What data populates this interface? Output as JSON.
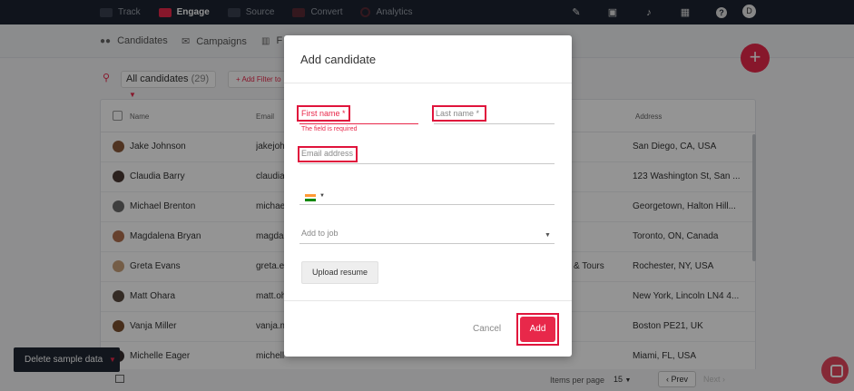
{
  "topnav": {
    "items": [
      {
        "label": "Track",
        "icon": "track-icon"
      },
      {
        "label": "Engage",
        "icon": "engage-icon"
      },
      {
        "label": "Source",
        "icon": "source-icon"
      },
      {
        "label": "Convert",
        "icon": "convert-icon"
      },
      {
        "label": "Analytics",
        "icon": "analytics-icon"
      }
    ],
    "active": "Engage",
    "right_icons": [
      "wand-icon",
      "clipboard-icon",
      "bell-icon",
      "calendar-icon",
      "help-icon"
    ],
    "avatar_initial": "D"
  },
  "subnav": {
    "tabs": [
      {
        "label": "Candidates",
        "icon": "people-icon"
      },
      {
        "label": "Campaigns",
        "icon": "mail-icon"
      },
      {
        "label": "F",
        "icon": "board-icon"
      }
    ],
    "fab_label": "+"
  },
  "filters": {
    "select_label": "All candidates",
    "select_count": "(29)",
    "add_filter_label": "+ Add Filter to"
  },
  "table": {
    "headers": {
      "name": "Name",
      "email": "Email",
      "address": "Address"
    },
    "rows": [
      {
        "name": "Jake Johnson",
        "email": "jakejoh",
        "company": "",
        "address": "San Diego, CA, USA",
        "avatar_color": "#8a5a3c"
      },
      {
        "name": "Claudia Barry",
        "email": "claudia",
        "company": "",
        "address": "123 Washington St, San ...",
        "avatar_color": "#4a3a34"
      },
      {
        "name": "Michael Brenton",
        "email": "michae",
        "company": "",
        "address": "Georgetown, Halton Hill...",
        "avatar_color": "#6b6b6b"
      },
      {
        "name": "Magdalena Bryan",
        "email": "magdal",
        "company": "",
        "address": "Toronto, ON, Canada",
        "avatar_color": "#b07050"
      },
      {
        "name": "Greta Evans",
        "email": "greta.ev",
        "company": "& Tours",
        "address": "Rochester, NY, USA",
        "avatar_color": "#c9a07a"
      },
      {
        "name": "Matt Ohara",
        "email": "matt.oh",
        "company": "",
        "address": "New York, Lincoln LN4 4...",
        "avatar_color": "#5a4a40"
      },
      {
        "name": "Vanja Miller",
        "email": "vanja.m",
        "company": "",
        "address": "Boston PE21, UK",
        "avatar_color": "#7a5030"
      },
      {
        "name": "Michelle Eager",
        "email": "michell",
        "company": "",
        "address": "Miami, FL, USA",
        "avatar_color": "#3a3030"
      }
    ]
  },
  "pagination": {
    "items_per_page_label": "Items per page",
    "items_per_page_value": "15",
    "prev_label": "Prev",
    "next_label": "Next"
  },
  "delete_sample": {
    "label": "Delete sample data"
  },
  "modal": {
    "title": "Add candidate",
    "first_name_placeholder": "First name *",
    "last_name_placeholder": "Last name *",
    "error_text": "The field is required",
    "email_placeholder": "Email address",
    "add_to_job_placeholder": "Add to job",
    "upload_label": "Upload resume",
    "cancel_label": "Cancel",
    "add_label": "Add"
  },
  "colors": {
    "accent": "#e8284a",
    "topbar": "#1c2331",
    "highlight_box": "#e0143c"
  }
}
